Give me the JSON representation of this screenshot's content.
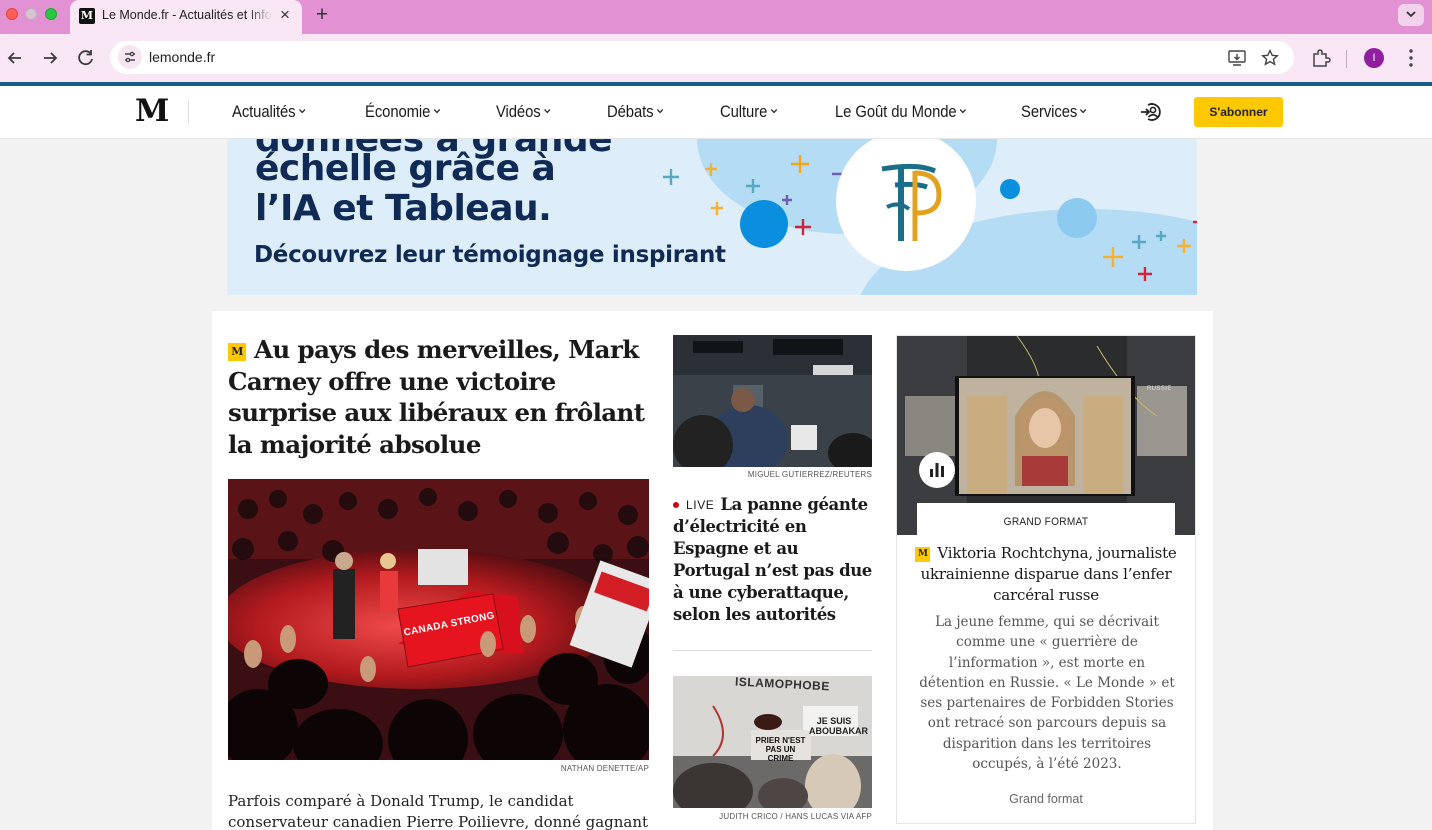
{
  "browser": {
    "tab_title": "Le Monde.fr - Actualités et Infos",
    "tab_favicon": "M",
    "url": "lemonde.fr",
    "profile_initial": "I"
  },
  "header": {
    "logo": "M",
    "nav": [
      {
        "label": "Actualités"
      },
      {
        "label": "Économie"
      },
      {
        "label": "Vidéos"
      },
      {
        "label": "Débats"
      },
      {
        "label": "Culture"
      },
      {
        "label": "Le Goût du Monde"
      },
      {
        "label": "Services"
      }
    ],
    "subscribe_label": "S'abonner"
  },
  "ad": {
    "line1": "données à grande",
    "line2": "échelle grâce à",
    "line3": "l’IA et Tableau.",
    "subline": "Découvrez leur témoignage inspirant"
  },
  "main_article": {
    "badge": "M",
    "title": "Au pays des merveilles, Mark Carney offre une victoire surprise aux libéraux en frôlant la majorité absolue",
    "image_sign": "CANADA STRONG",
    "credit": "NATHAN DENETTE/AP",
    "lead": "Parfois comparé à Donald Trump, le candidat conservateur canadien Pierre Poilievre, donné gagnant il"
  },
  "side_article": {
    "credit": "MIGUEL GUTIERREZ/REUTERS",
    "live_label": "LIVE",
    "title": "La panne géante d’électricité en Espagne et au Portugal n’est pas due à une cyberattaque, selon les autorités"
  },
  "side_article2": {
    "sign1": "ISLAMOPHOBE",
    "sign2": "JE SUIS ABOUBAKAR",
    "sign3": "PRIER N'EST PAS UN CRIME",
    "credit": "JUDITH CRICO / HANS LUCAS VIA AFP"
  },
  "feature_card": {
    "label": "GRAND FORMAT",
    "badge": "M",
    "title": "Viktoria Rochtchyna, journaliste ukrainienne disparue dans l’enfer carcéral russe",
    "text": "La jeune femme, qui se décrivait comme une « guerrière de l’information », est morte en détention en Russie. « Le Monde » et ses partenaires de Forbidden Stories ont retracé son parcours depuis sa disparition dans les territoires occupés, à l’été 2023.",
    "link": "Grand format",
    "map_label": "RUSSIE"
  },
  "colors": {
    "tabbar": "#e292d2",
    "toolbar": "#f9e7f5",
    "accent_blue": "#1b5a8c",
    "subscribe": "#ffc800",
    "live_red": "#d0021b"
  }
}
